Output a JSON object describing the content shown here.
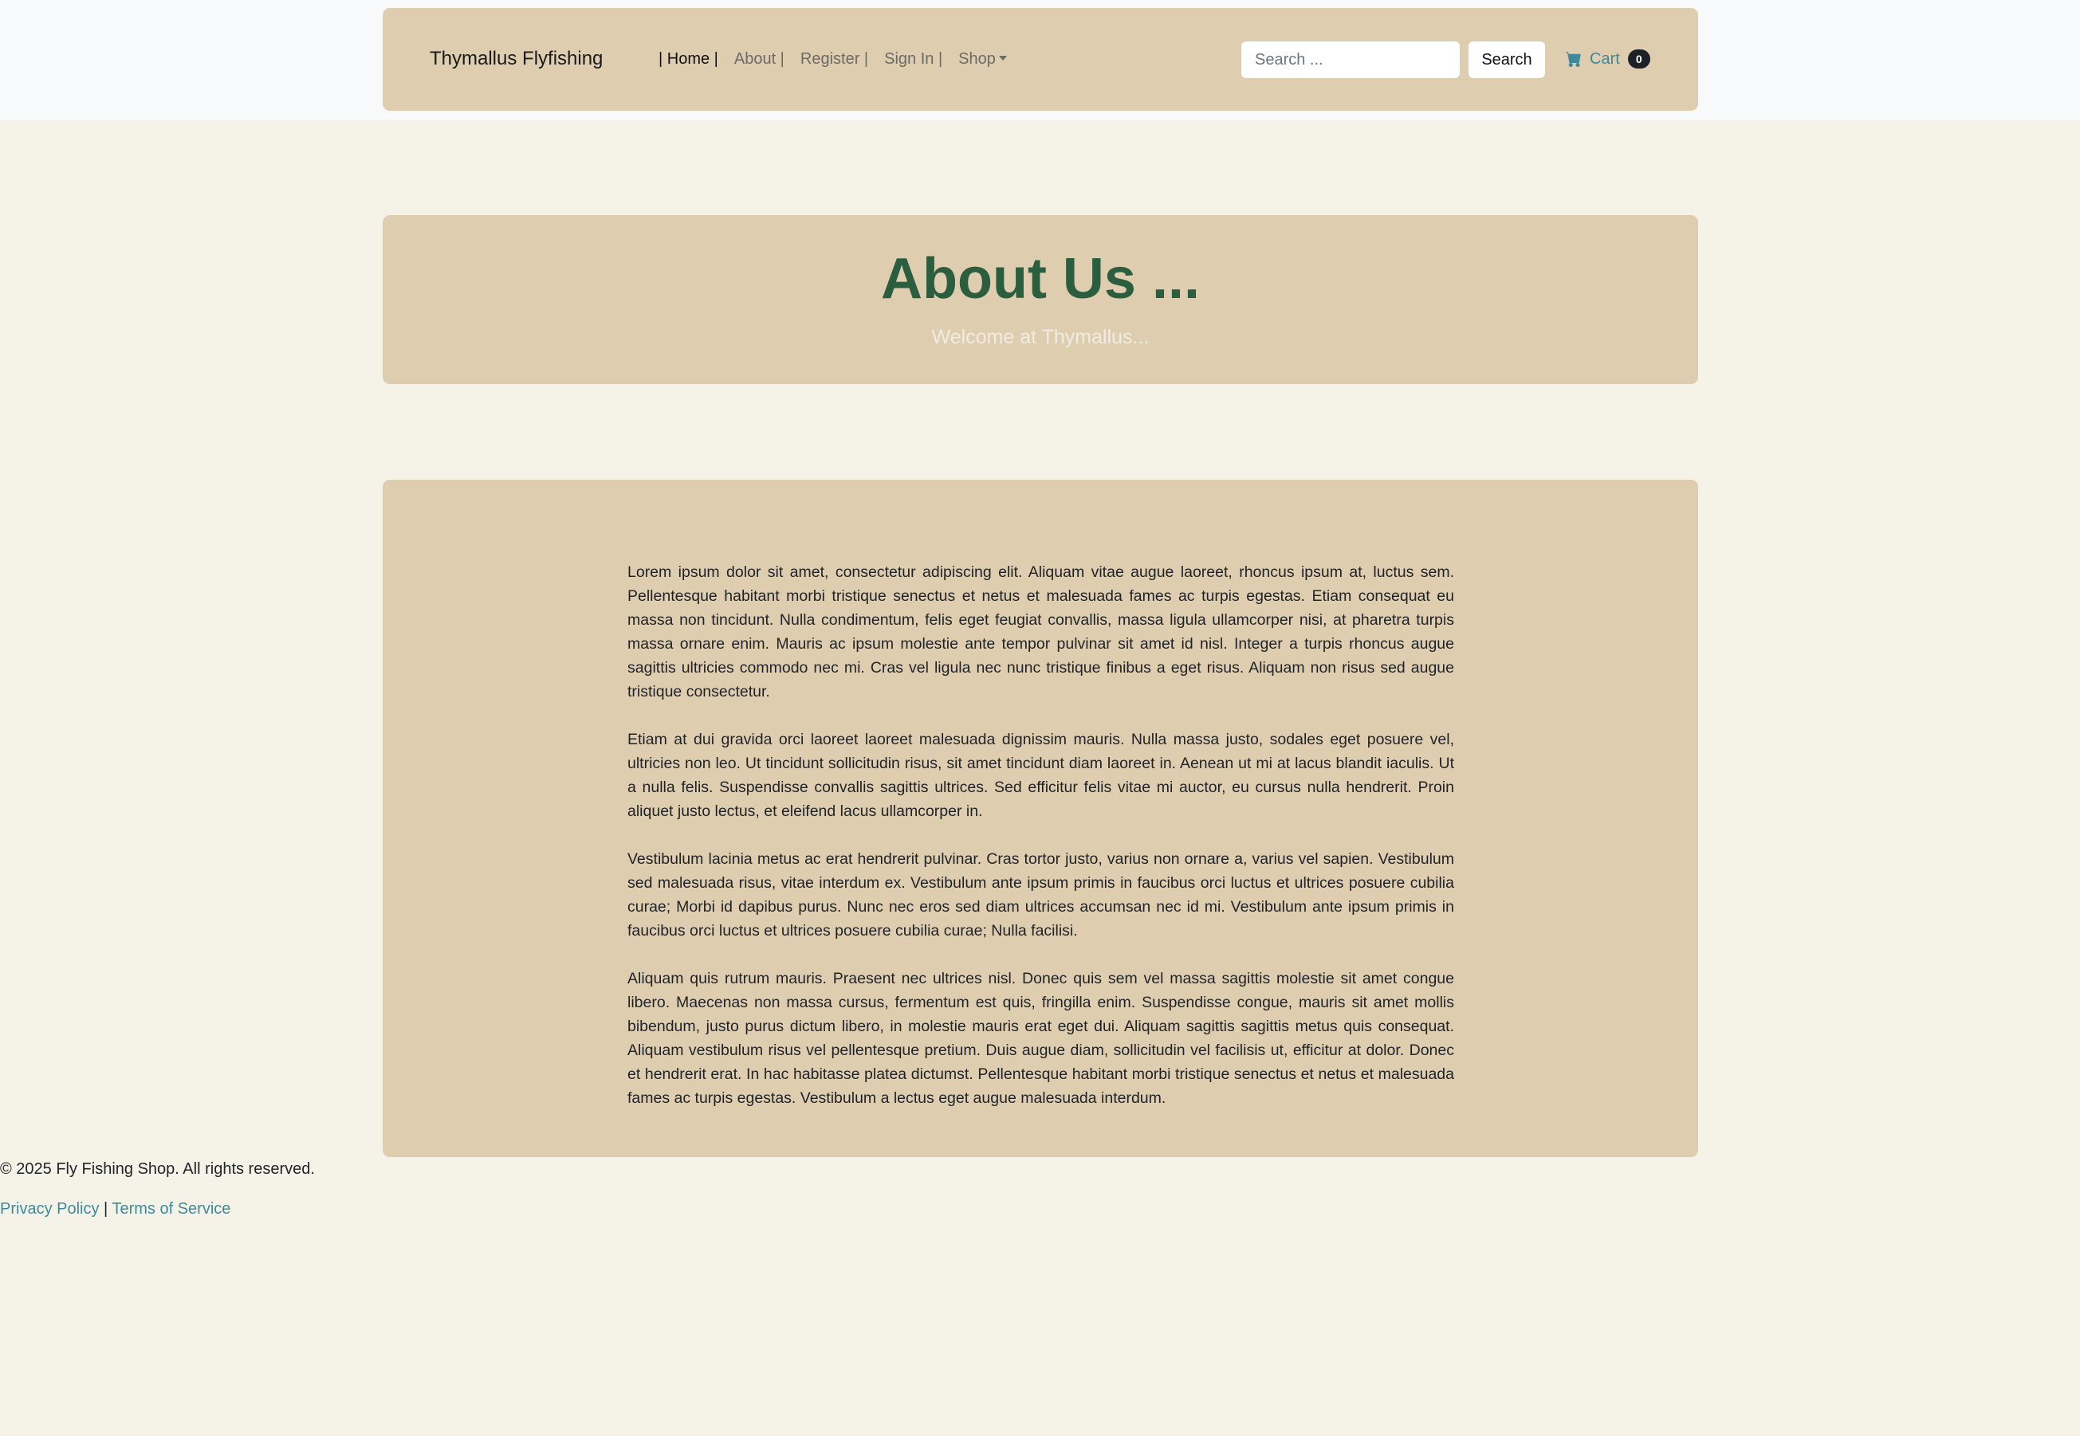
{
  "navbar": {
    "brand": "Thymallus Flyfishing",
    "links": [
      {
        "label": "| Home |",
        "active": true
      },
      {
        "label": "About |",
        "active": false
      },
      {
        "label": "Register |",
        "active": false
      },
      {
        "label": "Sign In |",
        "active": false
      },
      {
        "label": "Shop",
        "active": false,
        "dropdown": true
      }
    ],
    "search": {
      "placeholder": "Search ...",
      "value": "",
      "button_label": "Search"
    },
    "cart": {
      "icon": "cart-icon",
      "label": "Cart",
      "count": "0"
    }
  },
  "hero": {
    "title": "About Us ...",
    "subtitle": "Welcome at Thymallus..."
  },
  "content": {
    "paragraphs": [
      "Lorem ipsum dolor sit amet, consectetur adipiscing elit. Aliquam vitae augue laoreet, rhoncus ipsum at, luctus sem. Pellentesque habitant morbi tristique senectus et netus et malesuada fames ac turpis egestas. Etiam consequat eu massa non tincidunt. Nulla condimentum, felis eget feugiat convallis, massa ligula ullamcorper nisi, at pharetra turpis massa ornare enim. Mauris ac ipsum molestie ante tempor pulvinar sit amet id nisl. Integer a turpis rhoncus augue sagittis ultricies commodo nec mi. Cras vel ligula nec nunc tristique finibus a eget risus. Aliquam non risus sed augue tristique consectetur.",
      "Etiam at dui gravida orci laoreet laoreet malesuada dignissim mauris. Nulla massa justo, sodales eget posuere vel, ultricies non leo. Ut tincidunt sollicitudin risus, sit amet tincidunt diam laoreet in. Aenean ut mi at lacus blandit iaculis. Ut a nulla felis. Suspendisse convallis sagittis ultrices. Sed efficitur felis vitae mi auctor, eu cursus nulla hendrerit. Proin aliquet justo lectus, et eleifend lacus ullamcorper in.",
      "Vestibulum lacinia metus ac erat hendrerit pulvinar. Cras tortor justo, varius non ornare a, varius vel sapien. Vestibulum sed malesuada risus, vitae interdum ex. Vestibulum ante ipsum primis in faucibus orci luctus et ultrices posuere cubilia curae; Morbi id dapibus purus. Nunc nec eros sed diam ultrices accumsan nec id mi. Vestibulum ante ipsum primis in faucibus orci luctus et ultrices posuere cubilia curae; Nulla facilisi.",
      "Aliquam quis rutrum mauris. Praesent nec ultrices nisl. Donec quis sem vel massa sagittis molestie sit amet congue libero. Maecenas non massa cursus, fermentum est quis, fringilla enim. Suspendisse congue, mauris sit amet mollis bibendum, justo purus dictum libero, in molestie mauris erat eget dui. Aliquam sagittis sagittis metus quis consequat. Aliquam vestibulum risus vel pellentesque pretium. Duis augue diam, sollicitudin vel facilisis ut, efficitur at dolor. Donec et hendrerit erat. In hac habitasse platea dictumst. Pellentesque habitant morbi tristique senectus et netus et malesuada fames ac turpis egestas. Vestibulum a lectus eget augue malesuada interdum."
    ]
  },
  "footer": {
    "copyright": "© 2025 Fly Fishing Shop. All rights reserved.",
    "privacy_label": "Privacy Policy",
    "separator": "|",
    "terms_label": "Terms of Service"
  },
  "colors": {
    "page_background": "#f5f3e7",
    "topbar_background": "#f8f9fa",
    "panel_background": "#dfcdb0",
    "hero_title": "#2a5e3e",
    "link_accent": "#3f8a9a"
  }
}
